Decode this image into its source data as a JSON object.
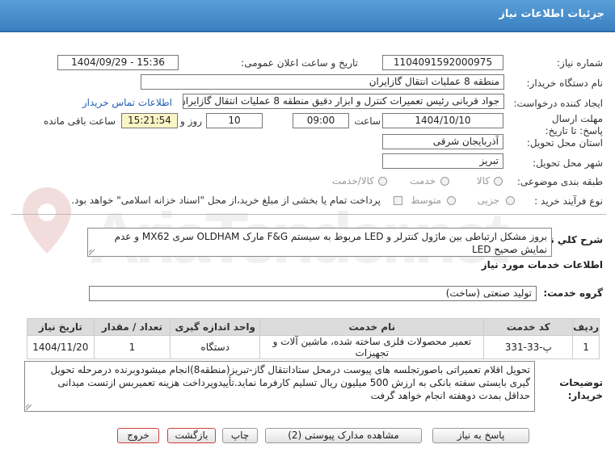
{
  "header": {
    "title": "جزئیات اطلاعات نیاز"
  },
  "form": {
    "need_number_label": "شماره نیاز:",
    "need_number": "1104091592000975",
    "announce_label": "تاریخ و ساعت اعلان عمومی:",
    "announce_value": "1404/09/29 - 15:36",
    "buyer_label": "نام دستگاه خریدار:",
    "buyer_value": "منطقه 8 عملیات انتقال گازایران",
    "creator_label": "ایجاد کننده درخواست:",
    "creator_value": "جواد قربانی رئیس تعمیرات کنترل و ابزار دقیق منطقه 8 عملیات انتقال گازایران",
    "contact_link": "اطلاعات تماس خریدار",
    "deadline_label": "مهلت ارسال پاسخ: تا تاریخ:",
    "deadline_date": "1404/10/10",
    "time_label": "ساعت",
    "deadline_time": "09:00",
    "days_value": "10",
    "days_label": "روز و",
    "remaining_time": "15:21:54",
    "remaining_label": "ساعت باقی مانده",
    "province_label": "استان محل تحویل:",
    "province_value": "آذربایجان شرقی",
    "city_label": "شهر محل تحویل:",
    "city_value": "تبریز",
    "category_label": "طبقه بندی موضوعی:",
    "category_options": [
      "کالا",
      "خدمت",
      "کالا/خدمت"
    ],
    "process_label": "نوع فرآیند خرید :",
    "process_options": [
      "جزیی",
      "متوسط"
    ],
    "payment_note": "پرداخت تمام یا بخشی از مبلغ خرید،از محل \"اسناد خزانه اسلامی\" خواهد بود."
  },
  "summary": {
    "label": "شرح کلي نياز:",
    "text": "بروز مشکل ارتباطی بین ماژول کنترلر و LED مربوط به سیستم F&G مارک OLDHAM سری MX62 و عدم نمایش صحیح LED"
  },
  "services": {
    "section_title": "اطلاعات خدمات مورد نیاز",
    "group_label": "گروه خدمت:",
    "group_value": "تولید صنعتی (ساخت)",
    "columns": [
      "ردیف",
      "کد خدمت",
      "نام خدمت",
      "واحد اندازه گیری",
      "تعداد / مقدار",
      "تاریخ نیاز"
    ],
    "rows": [
      [
        "1",
        "پ-33-331",
        "تعمیر محصولات فلزی ساخته شده، ماشین آلات و تجهیزات",
        "دستگاه",
        "1",
        "1404/11/20"
      ]
    ]
  },
  "buyer_notes": {
    "label": "توضیحات خریدار:",
    "text": "تحویل اقلام تعمیراتی باصورتجلسه های پیوست درمحل ستادانتقال گاز-تبریز(منطقه8)انجام میشودوبرنده درمرحله تحویل گیری بایستی سفته بانکی به ارزش 500 میلیون ریال تسلیم کارفرما نماید.تأییدوپرداخت هزینه تعمیربس ازتست میدانی حداقل بمدت دوهفته انجام خواهد گرفت"
  },
  "buttons": {
    "reply": "پاسخ به نیاز",
    "attachments": "مشاهده مدارک پیوستی (2)",
    "print": "چاپ",
    "back": "بازگشت",
    "exit": "خروج"
  },
  "watermark": {
    "text": "AriaTender.net"
  },
  "colors": {
    "header": "#3a80c2",
    "highlight": "#fbf5c6",
    "link": "#1f5fb5",
    "watermark": "#e8c9c9"
  }
}
